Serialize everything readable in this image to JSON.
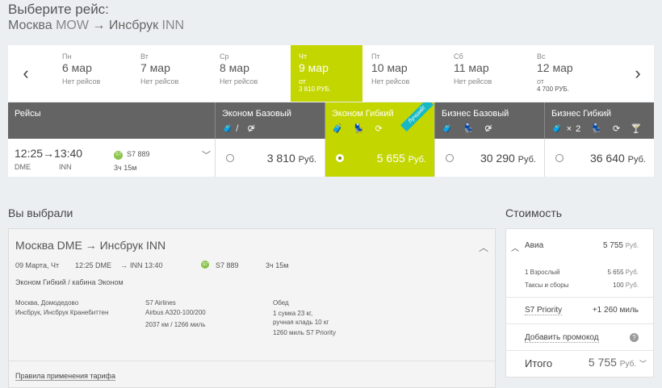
{
  "header": {
    "title": "Выберите рейс:",
    "from": "Москва",
    "from_code": "MOW",
    "to": "Инсбрук",
    "to_code": "INN"
  },
  "dates": [
    {
      "dow": "Пн",
      "date": "6 мар",
      "note": "Нет рейсов",
      "price": ""
    },
    {
      "dow": "Вт",
      "date": "7 мар",
      "note": "Нет рейсов",
      "price": ""
    },
    {
      "dow": "Ср",
      "date": "8 мар",
      "note": "Нет рейсов",
      "price": ""
    },
    {
      "dow": "Чт",
      "date": "9 мар",
      "note": "от",
      "price": "3 810 РУБ."
    },
    {
      "dow": "Пт",
      "date": "10 мар",
      "note": "Нет рейсов",
      "price": ""
    },
    {
      "dow": "Сб",
      "date": "11 мар",
      "note": "Нет рейсов",
      "price": ""
    },
    {
      "dow": "Вс",
      "date": "12 мар",
      "note": "от",
      "price": "4 700 РУБ."
    }
  ],
  "table": {
    "flights_header": "Рейсы",
    "fares": [
      {
        "name": "Эконом Базовый",
        "icons": "🧳̸ ⟳̸"
      },
      {
        "name": "Эконом Гибкий",
        "icons": "🧳 💺 ⟳"
      },
      {
        "name": "Бизнес Базовый",
        "icons": "🧳 💺 ⟳̸"
      },
      {
        "name": "Бизнес Гибкий",
        "icons": "🧳×2 💺 ⟳ 🍸"
      }
    ],
    "best_badge": "Лучший!"
  },
  "flight": {
    "depart": "12:25",
    "arrive": "13:40",
    "dep_code": "DME",
    "arr_code": "INN",
    "logo": "S7",
    "number": "S7 889",
    "duration": "3ч 15м",
    "prices": [
      "3 810",
      "5 655",
      "30 290",
      "36 640"
    ],
    "currency": "Руб."
  },
  "selected": {
    "title": "Вы выбрали",
    "route": "Москва DME → Инсбрук INN",
    "date": "09 Марта, Чт",
    "dep": "12:25 DME",
    "arr": "INN 13:40",
    "flight": "S7 889",
    "duration": "3ч 15м",
    "fare": "Эконом Гибкий / кабина Эконом",
    "from_airport": "Москва, Домодедово",
    "to_airport": "Инсбрук, Инсбрук Кранебиттен",
    "airline": "S7 Airlines",
    "aircraft": "Airbus A320-100/200",
    "distance": "2037 км / 1266 миль",
    "meal": "Обед",
    "baggage1": "1 сумка 23 кг,",
    "baggage2": "ручная кладь 10 кг",
    "miles": "1260 миль S7 Priority",
    "tariff_rules": "Правила применения тарифа"
  },
  "cost": {
    "title": "Стоимость",
    "avia_label": "Авиа",
    "avia_value": "5 755",
    "avia_cur": "Руб.",
    "adult_label": "1 Взрослый",
    "adult_value": "5 655",
    "taxes_label": "Таксы и сборы",
    "taxes_value": "100",
    "cur": "Руб.",
    "priority_label": "S7 Priority",
    "priority_value": "+1 260 миль",
    "promo_label": "Добавить промокод",
    "help": "?",
    "total_label": "Итого",
    "total_value": "5 755",
    "total_cur": "Руб."
  }
}
